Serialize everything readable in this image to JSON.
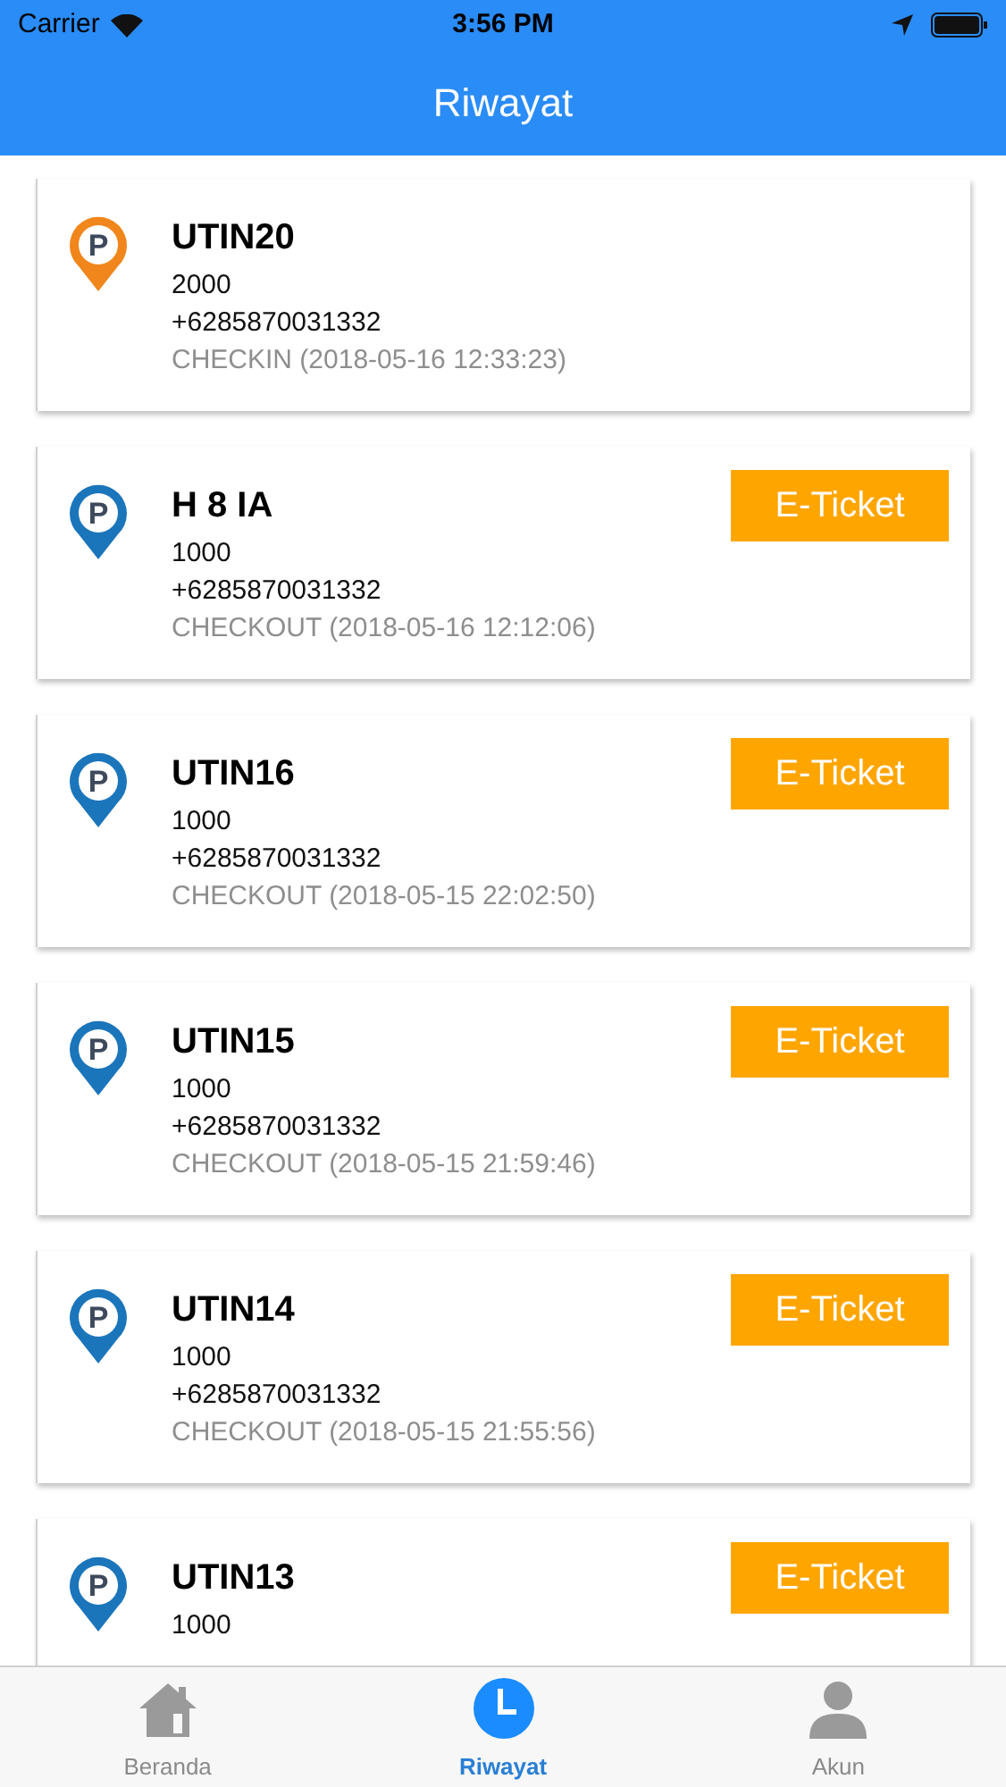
{
  "status_bar": {
    "carrier": "Carrier",
    "time": "3:56 PM"
  },
  "header": {
    "title": "Riwayat"
  },
  "items": [
    {
      "name": "UTIN20",
      "amount": "2000",
      "phone": "+6285870031332",
      "status": "CHECKIN (2018-05-16 12:33:23)",
      "color": "#f0861c",
      "pin_label": "P"
    },
    {
      "name": "H 8 IA",
      "amount": "1000",
      "phone": "+6285870031332",
      "status": "CHECKOUT (2018-05-16 12:12:06)",
      "color": "#1b75bb",
      "pin_label": "P",
      "button": "E-Ticket"
    },
    {
      "name": "UTIN16",
      "amount": "1000",
      "phone": "+6285870031332",
      "status": "CHECKOUT (2018-05-15 22:02:50)",
      "color": "#1b75bb",
      "pin_label": "P",
      "button": "E-Ticket"
    },
    {
      "name": "UTIN15",
      "amount": "1000",
      "phone": "+6285870031332",
      "status": "CHECKOUT (2018-05-15 21:59:46)",
      "color": "#1b75bb",
      "pin_label": "P",
      "button": "E-Ticket"
    },
    {
      "name": "UTIN14",
      "amount": "1000",
      "phone": "+6285870031332",
      "status": "CHECKOUT (2018-05-15 21:55:56)",
      "color": "#1b75bb",
      "pin_label": "P",
      "button": "E-Ticket"
    },
    {
      "name": "UTIN13",
      "amount": "1000",
      "color": "#1b75bb",
      "pin_label": "P",
      "button": "E-Ticket"
    }
  ],
  "tabs": [
    {
      "label": "Beranda",
      "kind": "home",
      "selected": false
    },
    {
      "label": "Riwayat",
      "kind": "history",
      "selected": true
    },
    {
      "label": "Akun",
      "kind": "account",
      "selected": false
    }
  ]
}
